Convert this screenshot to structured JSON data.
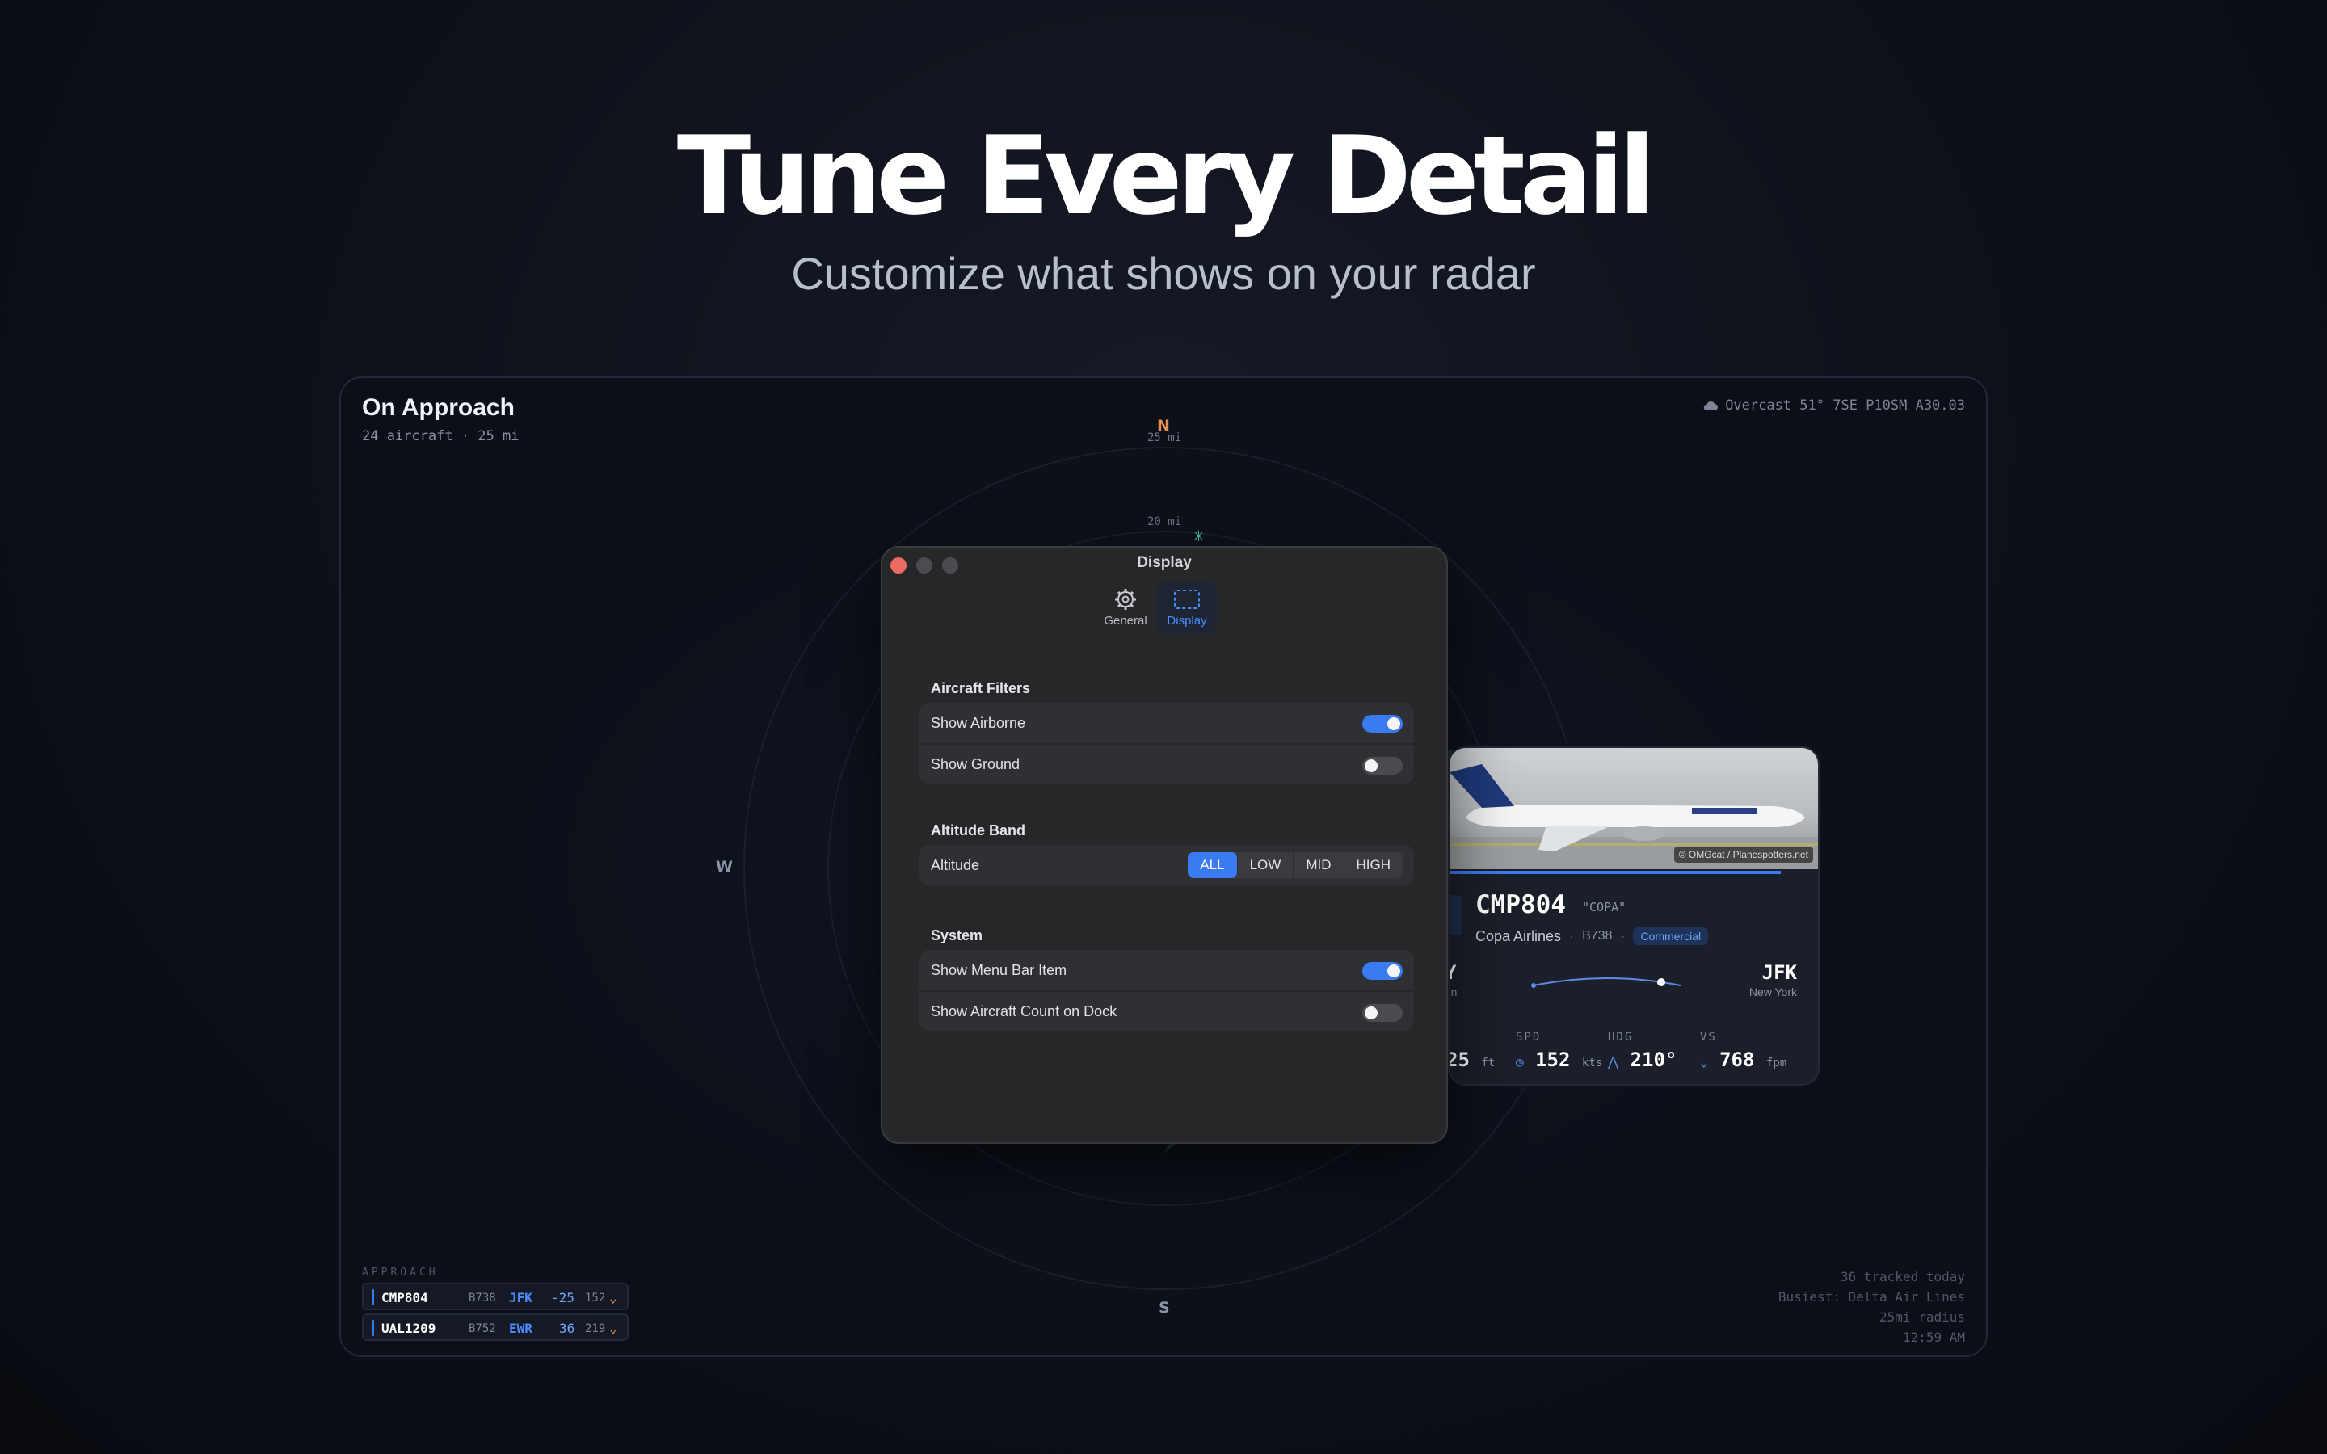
{
  "hero": {
    "title": "Tune Every Detail",
    "subtitle": "Customize what shows on your radar"
  },
  "app": {
    "title": "On Approach",
    "meta": "24 aircraft  ·  25 mi",
    "weather": "Overcast 51° 7SE P10SM A30.03"
  },
  "radar": {
    "rings": [
      "25 mi",
      "20 mi"
    ],
    "compass": {
      "north": "N",
      "south": "S",
      "west": "W"
    }
  },
  "settings": {
    "window_title": "Display",
    "tabs": [
      {
        "label": "General",
        "icon": "gear-icon"
      },
      {
        "label": "Display",
        "icon": "display-icon"
      }
    ],
    "sections": {
      "aircraft_filters": {
        "heading": "Aircraft Filters",
        "rows": [
          {
            "label": "Show Airborne",
            "on": true
          },
          {
            "label": "Show Ground",
            "on": false
          }
        ]
      },
      "altitude_band": {
        "heading": "Altitude Band",
        "label": "Altitude",
        "options": [
          "ALL",
          "LOW",
          "MID",
          "HIGH"
        ],
        "selected": "ALL"
      },
      "system": {
        "heading": "System",
        "rows": [
          {
            "label": "Show Menu Bar Item",
            "on": true
          },
          {
            "label": "Show Aircraft Count on Dock",
            "on": false
          }
        ]
      }
    }
  },
  "card": {
    "photo_credit": "© OMGcat / Planespotters.net",
    "callsign": "CMP804",
    "nickname": "\"COPA\"",
    "airline": "Copa Airlines",
    "aircraft": "B738",
    "category": "Commercial",
    "origin_code": "Y",
    "origin_city": "nen",
    "dest_code": "JFK",
    "dest_city": "New York",
    "stats": {
      "alt": {
        "value": "25",
        "unit": "ft"
      },
      "spd": {
        "label": "SPD",
        "value": "152",
        "unit": "kts"
      },
      "hdg": {
        "label": "HDG",
        "value": "210°"
      },
      "vs": {
        "label": "VS",
        "value": "768",
        "unit": "fpm"
      }
    }
  },
  "approach": {
    "label": "APPROACH",
    "flights": [
      {
        "callsign": "CMP804",
        "type": "B738",
        "dest": "JFK",
        "alt": "-25",
        "spd": "152"
      },
      {
        "callsign": "UAL1209",
        "type": "B752",
        "dest": "EWR",
        "alt": "36",
        "spd": "219"
      }
    ]
  },
  "summary": {
    "tracked": "36 tracked today",
    "busiest": "Busiest: Delta Air Lines",
    "radius": "25mi radius",
    "time": "12:59 AM"
  }
}
